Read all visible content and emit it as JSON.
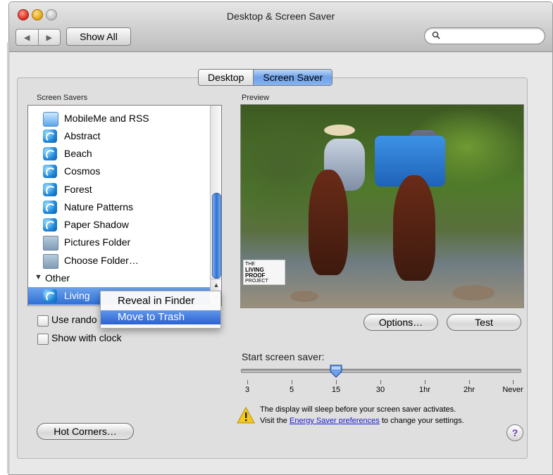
{
  "window": {
    "title": "Desktop & Screen Saver"
  },
  "toolbar": {
    "back_icon": "back-arrow-icon",
    "forward_icon": "forward-arrow-icon",
    "show_all": "Show All",
    "search_placeholder": ""
  },
  "tabs": [
    {
      "label": "Desktop",
      "active": false
    },
    {
      "label": "Screen Saver",
      "active": true
    }
  ],
  "screen_savers": {
    "label": "Screen Savers",
    "items": [
      {
        "label": "MobileMe and RSS",
        "icon": "mobileme-icon"
      },
      {
        "label": "Abstract",
        "icon": "screensaver-swirl-icon"
      },
      {
        "label": "Beach",
        "icon": "screensaver-swirl-icon"
      },
      {
        "label": "Cosmos",
        "icon": "screensaver-swirl-icon"
      },
      {
        "label": "Forest",
        "icon": "screensaver-swirl-icon"
      },
      {
        "label": "Nature Patterns",
        "icon": "screensaver-swirl-icon"
      },
      {
        "label": "Paper Shadow",
        "icon": "screensaver-swirl-icon"
      },
      {
        "label": "Pictures Folder",
        "icon": "pictures-folder-icon"
      },
      {
        "label": "Choose Folder…",
        "icon": "folder-icon"
      }
    ],
    "group_label": "Other",
    "selected_item": "Living"
  },
  "context_menu": {
    "items": [
      {
        "label": "Reveal in Finder",
        "highlighted": false
      },
      {
        "label": "Move to Trash",
        "highlighted": true
      }
    ]
  },
  "preview": {
    "label": "Preview",
    "logo_text": [
      "THE",
      "LIVING PROOF",
      "PROJECT"
    ]
  },
  "options": {
    "use_random_label": "Use rando",
    "use_random_checked": false,
    "show_clock_label": "Show with clock",
    "show_clock_checked": false
  },
  "buttons": {
    "options": "Options…",
    "test": "Test",
    "hot_corners": "Hot Corners…"
  },
  "start": {
    "label": "Start screen saver:",
    "ticks": [
      "3",
      "5",
      "15",
      "30",
      "1hr",
      "2hr",
      "Never"
    ],
    "selected": "15"
  },
  "warning": {
    "line1": "The display will sleep before your screen saver activates.",
    "line2_prefix": "Visit the ",
    "line2_link": "Energy Saver preferences",
    "line2_suffix": " to change your settings."
  },
  "help": "?",
  "colors": {
    "selection": "#2f6fd6",
    "window_bg": "#e8e8e8",
    "link": "#1b1bcf"
  }
}
